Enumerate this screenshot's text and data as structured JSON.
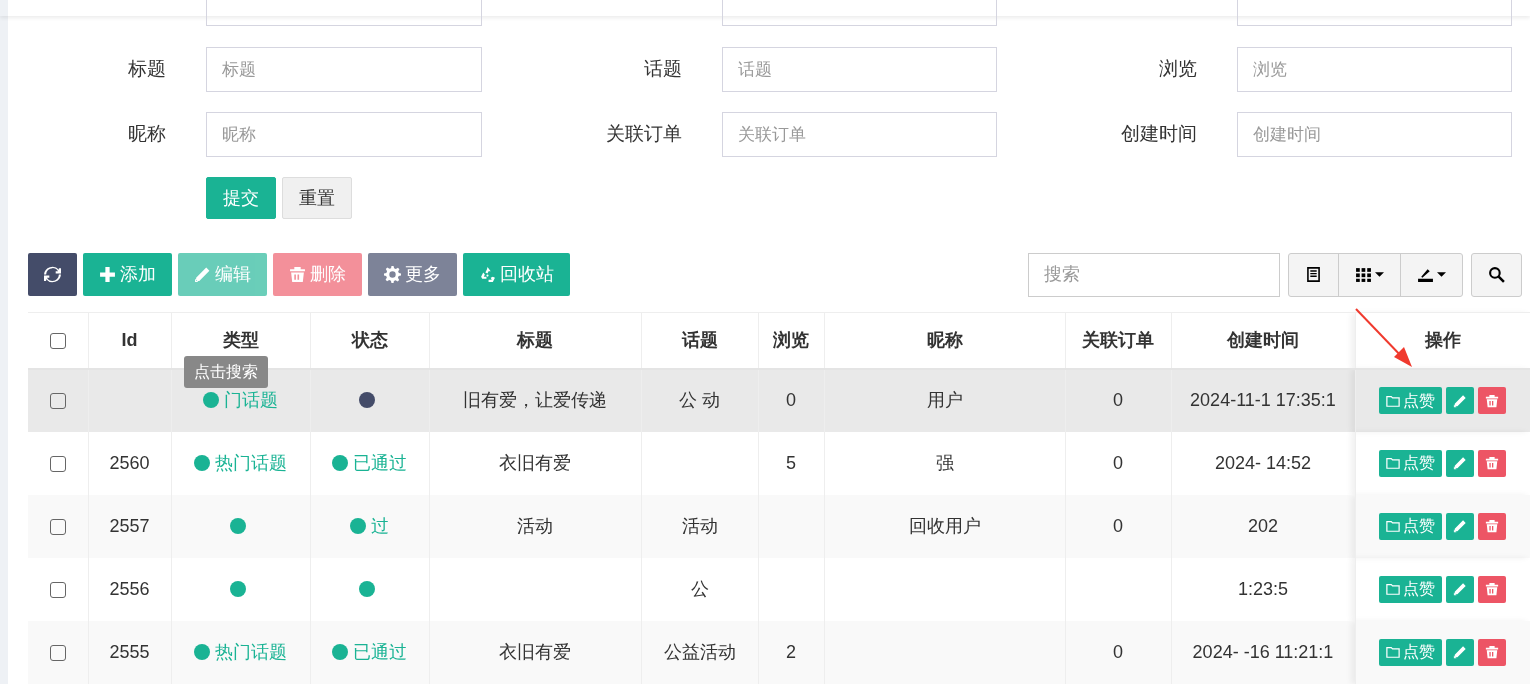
{
  "search_form": {
    "cut_fields": [
      {
        "kind": "input"
      },
      {
        "kind": "input"
      },
      {
        "kind": "input"
      }
    ],
    "fields": [
      {
        "label": "标题",
        "placeholder": "标题"
      },
      {
        "label": "话题",
        "placeholder": "话题"
      },
      {
        "label": "浏览",
        "placeholder": "浏览"
      },
      {
        "label": "昵称",
        "placeholder": "昵称"
      },
      {
        "label": "关联订单",
        "placeholder": "关联订单"
      },
      {
        "label": "创建时间",
        "placeholder": "创建时间"
      }
    ],
    "buttons": [
      {
        "kind": "submit",
        "label": "提交"
      },
      {
        "kind": "reset",
        "label": "重置"
      }
    ]
  },
  "toolbar": {
    "buttons": [
      {
        "kind": "refresh",
        "disabled": false
      },
      {
        "kind": "add",
        "label": "添加",
        "disabled": false
      },
      {
        "kind": "edit",
        "label": "编辑",
        "disabled": true
      },
      {
        "kind": "delete",
        "label": "删除",
        "disabled": true
      },
      {
        "kind": "more",
        "label": "更多",
        "disabled": false
      },
      {
        "kind": "recycle",
        "label": "回收站",
        "disabled": false
      }
    ],
    "search": {
      "placeholder": "搜索"
    },
    "tools": [
      {
        "kind": "list"
      },
      {
        "kind": "columns"
      },
      {
        "kind": "export"
      },
      {
        "kind": "search"
      }
    ]
  },
  "table": {
    "columns": [
      "Id",
      "类型",
      "状态",
      "标题",
      "话题",
      "浏览",
      "昵称",
      "关联订单",
      "创建时间",
      "操作"
    ],
    "tooltip": "点击搜索",
    "select_all_checked": false,
    "rows": [
      {
        "checked": false,
        "highlighted": true,
        "type": {
          "text": "门话题",
          "color": "#1ab394"
        },
        "status": {
          "color": "#444c69"
        },
        "title": "旧有爱，让爱传递",
        "topic": "公 动",
        "views": "0",
        "nickname": "用户",
        "order": "0",
        "created": "2024-11-1 17:35:1",
        "like": "点赞"
      },
      {
        "checked": false,
        "highlighted": false,
        "id": "2560",
        "type": {
          "text": "热门话题",
          "color": "#1ab394"
        },
        "status": {
          "text": "已通过",
          "color": "#1ab394"
        },
        "title": "衣旧有爱",
        "views": "5",
        "nickname": "强",
        "order": "0",
        "created": "2024- 14:52",
        "like": "点赞"
      },
      {
        "checked": false,
        "highlighted": false,
        "id": "2557",
        "type": {
          "color": "#1ab394"
        },
        "status": {
          "text": "过",
          "color": "#1ab394"
        },
        "title": "活动",
        "topic": "活动",
        "nickname": "回收用户",
        "order": "0",
        "created": "202",
        "like": "点赞"
      },
      {
        "checked": false,
        "highlighted": false,
        "id": "2556",
        "type": {
          "color": "#1ab394"
        },
        "status": {
          "color": "#1ab394"
        },
        "topic": "公",
        "created": "1:23:5",
        "like": "点赞"
      },
      {
        "checked": false,
        "highlighted": false,
        "id": "2555",
        "type": {
          "text": "热门话题",
          "color": "#1ab394"
        },
        "status": {
          "text": "已通过",
          "color": "#1ab394"
        },
        "title": "衣旧有爱",
        "topic": "公益活动",
        "views": "2",
        "order": "0",
        "created": "2024- -16 11:21:1",
        "like": "点赞"
      }
    ]
  }
}
